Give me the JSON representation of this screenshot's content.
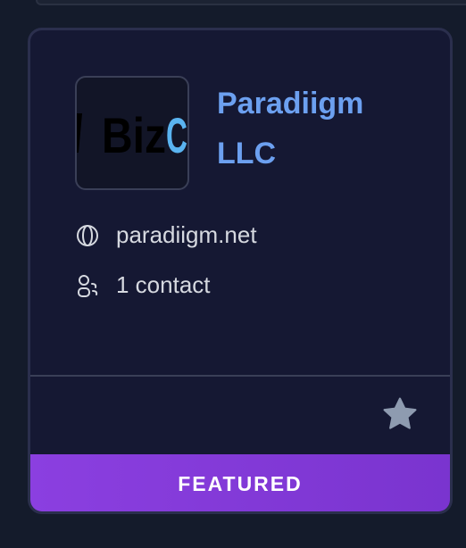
{
  "company": {
    "name": "Paradiigm LLC",
    "logo_text_dark": "Biz",
    "logo_text_accent": "C",
    "website": "paradiigm.net",
    "contacts": "1 contact"
  },
  "badge": {
    "label": "FEATURED"
  },
  "icons": {
    "website": "globe-icon",
    "contacts": "contacts-icon",
    "favorite": "star-icon"
  },
  "colors": {
    "name": "#6ca0f0",
    "featured": "#8b3fe0",
    "star": "#8e9bb0"
  }
}
